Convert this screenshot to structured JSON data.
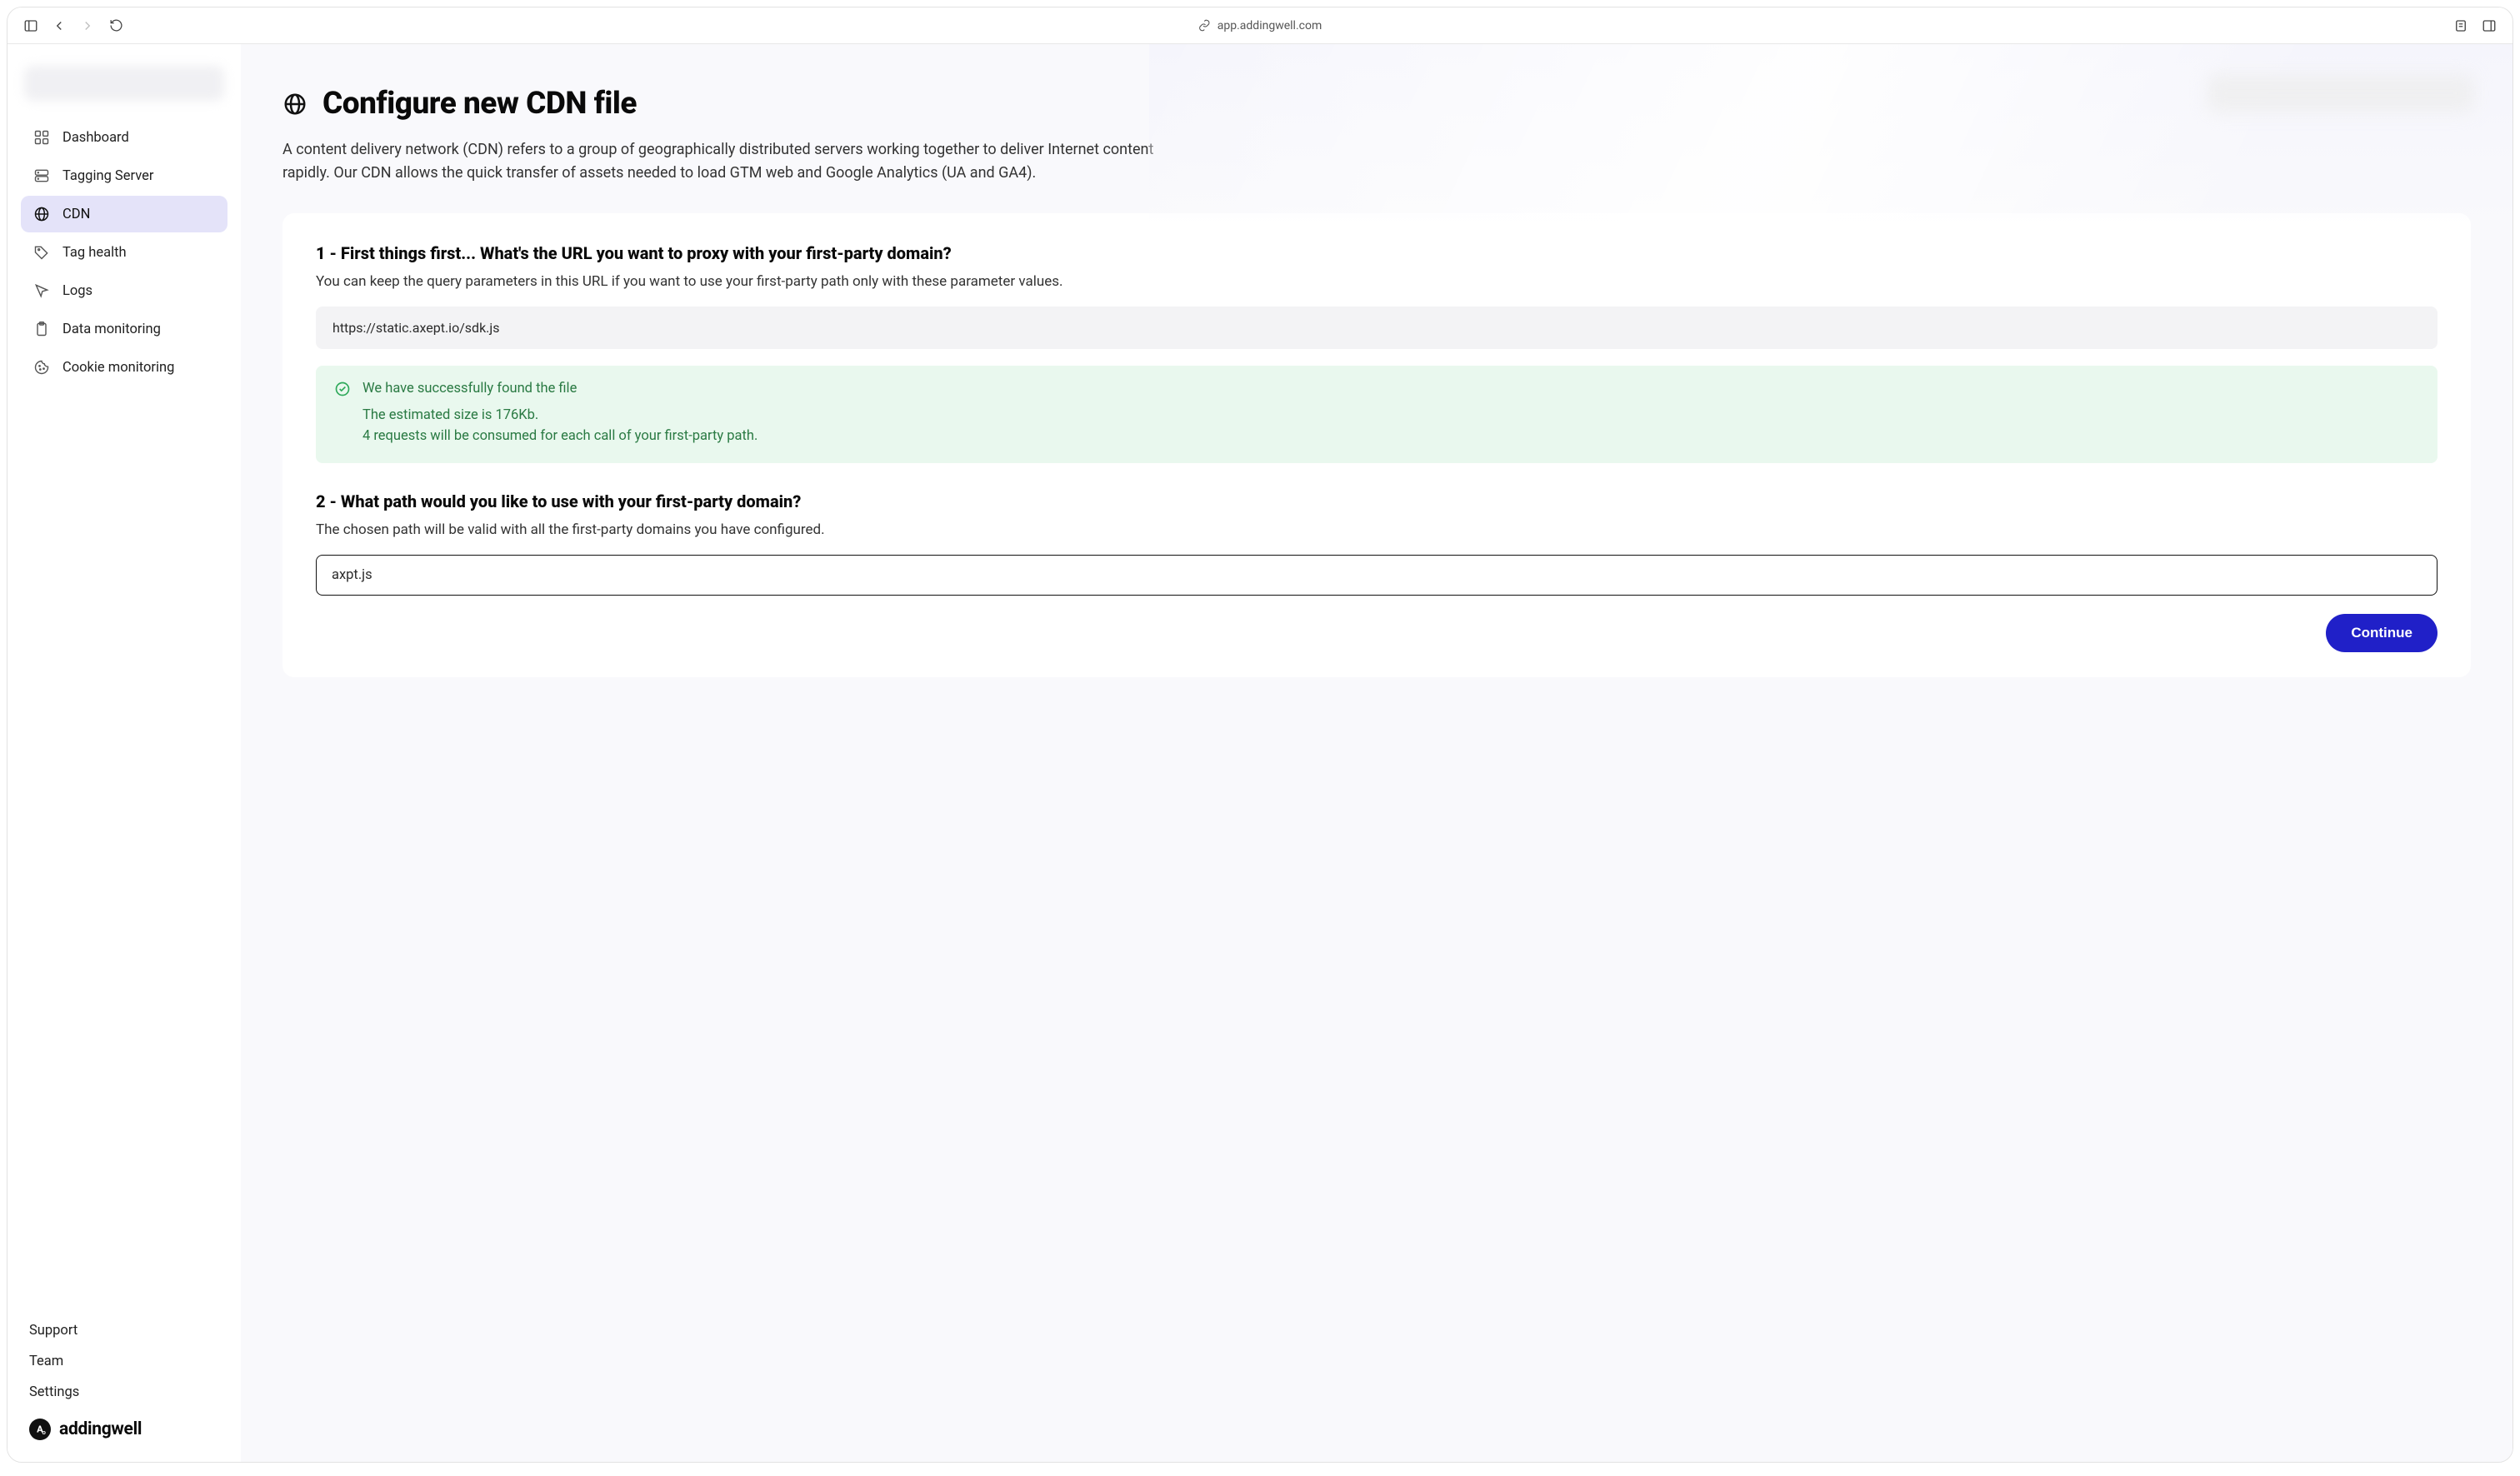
{
  "browser": {
    "url": "app.addingwell.com"
  },
  "sidebar": {
    "items": [
      {
        "label": "Dashboard",
        "icon": "grid"
      },
      {
        "label": "Tagging Server",
        "icon": "server"
      },
      {
        "label": "CDN",
        "icon": "globe"
      },
      {
        "label": "Tag health",
        "icon": "tag"
      },
      {
        "label": "Logs",
        "icon": "cursor"
      },
      {
        "label": "Data monitoring",
        "icon": "clipboard"
      },
      {
        "label": "Cookie monitoring",
        "icon": "cookie"
      }
    ],
    "bottom": {
      "support": "Support",
      "team": "Team",
      "settings": "Settings"
    },
    "brand": "addingwell"
  },
  "page": {
    "title": "Configure new CDN file",
    "description": "A content delivery network (CDN) refers to a group of geographically distributed servers working together to deliver Internet content rapidly. Our CDN allows the quick transfer of assets needed to load GTM web and Google Analytics (UA and GA4)."
  },
  "step1": {
    "title": "1 - First things first... What's the URL you want to proxy with your first-party domain?",
    "desc": "You can keep the query parameters in this URL if you want to use your first-party path only with these parameter values.",
    "url_value": "https://static.axept.io/sdk.js",
    "success_title": "We have successfully found the file",
    "success_line1": "The estimated size is 176Kb.",
    "success_line2": "4 requests will be consumed for each call of your first-party path."
  },
  "step2": {
    "title": "2 - What path would you like to use with your first-party domain?",
    "desc": "The chosen path will be valid with all the first-party domains you have configured.",
    "path_value": "axpt.js"
  },
  "actions": {
    "continue_label": "Continue"
  }
}
